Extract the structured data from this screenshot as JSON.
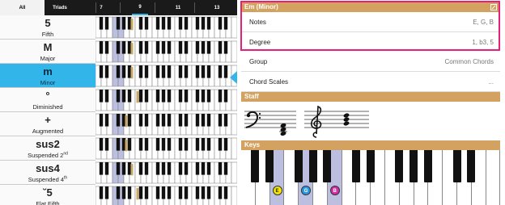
{
  "tabs": [
    {
      "label": "All",
      "active": true
    },
    {
      "label": "Triads",
      "active": false
    },
    {
      "label": "7",
      "active": false
    },
    {
      "label": "9",
      "active": false
    },
    {
      "label": "11",
      "active": false
    },
    {
      "label": "13",
      "active": false
    }
  ],
  "chords": [
    {
      "symbol": "5",
      "name": "Fifth",
      "sup": ""
    },
    {
      "symbol": "M",
      "name": "Major",
      "sup": ""
    },
    {
      "symbol": "m",
      "name": "Minor",
      "sup": "",
      "selected": true
    },
    {
      "symbol": "°",
      "name": "Diminished",
      "sup": ""
    },
    {
      "symbol": "+",
      "name": "Augmented",
      "sup": ""
    },
    {
      "symbol": "sus2",
      "name": "Suspended 2",
      "sup": "nd"
    },
    {
      "symbol": "sus4",
      "name": "Suspended 4",
      "sup": "th"
    },
    {
      "symbol": "˘5",
      "name": "Flat Fifth",
      "sup": ""
    }
  ],
  "chord_info": {
    "header": "Em (Minor)",
    "notes_label": "Notes",
    "notes_value": "E, G, B",
    "degree_label": "Degree",
    "degree_value": "1, b3, 5",
    "group_label": "Group",
    "group_value": "Common Chords",
    "scales_label": "Chord Scales",
    "scales_value": "..."
  },
  "staff": {
    "header": "Staff"
  },
  "keys": {
    "header": "Keys",
    "notes": [
      {
        "label": "E",
        "color": "#f4e600",
        "text_color": "#222"
      },
      {
        "label": "G",
        "color": "#2a9be0",
        "text_color": "#fff"
      },
      {
        "label": "B",
        "color": "#d42ca3",
        "text_color": "#fff"
      }
    ]
  },
  "colors": {
    "accent": "#32b6ea",
    "section": "#d3a160",
    "highlight": "#e51f7a",
    "key_highlight": "#bcbfe0",
    "marker": "#c9a968"
  },
  "icons": {
    "edit": "edit-icon",
    "arrow": "selection-arrow-icon"
  }
}
